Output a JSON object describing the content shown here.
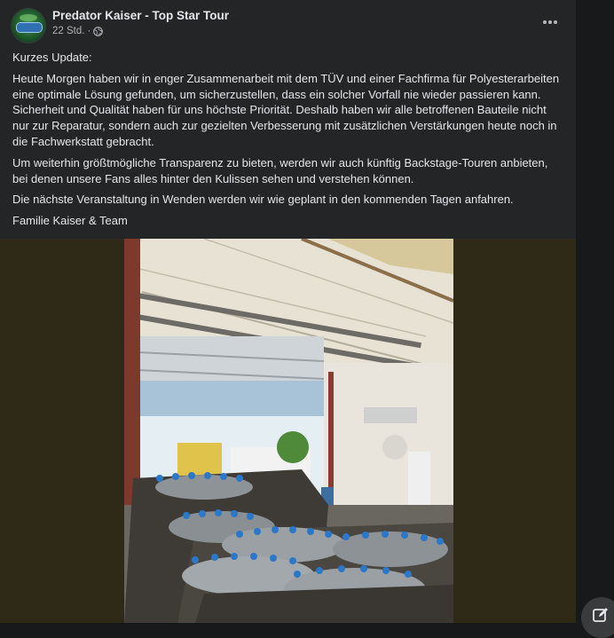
{
  "post": {
    "author": "Predator Kaiser - Top Star Tour",
    "time": "22 Std.",
    "separator": "·",
    "paragraphs": [
      "Kurzes Update:",
      "Heute Morgen haben wir in enger Zusammenarbeit mit dem TÜV und einer Fachfirma für Polyesterarbeiten eine optimale Lösung gefunden, um sicherzustellen, dass ein solcher Vorfall nie wieder passieren kann. Sicherheit und Qualität haben für uns höchste Priorität. Deshalb haben wir alle betroffenen Bauteile nicht nur zur Reparatur, sondern auch zur gezielten Verbesserung mit zusätzlichen Verstärkungen heute noch in die Fachwerkstatt gebracht.",
      "Um weiterhin größtmögliche Transparenz zu bieten, werden wir auch künftig Backstage-Touren anbieten, bei denen unsere Fans alles hinter den Kulissen sehen und verstehen können.",
      "Die nächste Veranstaltung in Wenden werden wir wie geplant in den kommenden Tagen anfahren.",
      "Familie Kaiser & Team"
    ]
  },
  "icons": {
    "avatar": "page-logo-avatar",
    "privacy": "globe-icon",
    "more": "more-options-icon",
    "compose": "compose-message-icon"
  },
  "colors": {
    "card": "#242526",
    "page": "#18191a",
    "text": "#e4e6eb",
    "secondary": "#b0b3b8",
    "media_backdrop": "#2f2a17"
  }
}
